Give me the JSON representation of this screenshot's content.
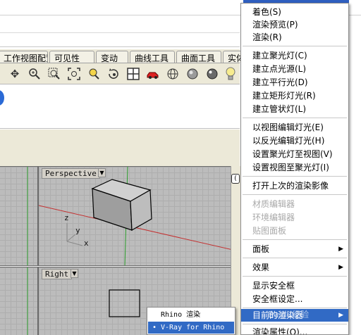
{
  "toolbar_tabs": [
    "工作视图配置",
    "可见性",
    "变动",
    "曲线工具",
    "曲面工具",
    "实体"
  ],
  "toolbar_icons": [
    "move-icon",
    "zoom-in-icon",
    "zoom-window-icon",
    "zoom-extents-icon",
    "zoom-selected-icon",
    "rotate-view-icon",
    "four-viewports-icon",
    "car-render-icon",
    "wireframe-icon",
    "shaded-icon",
    "rendered-icon",
    "light-bulb-icon"
  ],
  "viewports": {
    "perspective": {
      "title": "Perspective",
      "axis_x": "x",
      "axis_y": "y",
      "axis_z": "z"
    },
    "right": {
      "title": "Right"
    }
  },
  "side_tab_label": "(",
  "menu": {
    "items": [
      {
        "label": "着色(S)",
        "disabled": false,
        "submenu": false
      },
      {
        "label": "渲染预览(P)",
        "disabled": false,
        "submenu": false
      },
      {
        "label": "渲染(R)",
        "disabled": false,
        "submenu": false
      },
      {
        "label": "建立聚光灯(C)",
        "disabled": false,
        "submenu": false
      },
      {
        "label": "建立点光源(L)",
        "disabled": false,
        "submenu": false
      },
      {
        "label": "建立平行光(D)",
        "disabled": false,
        "submenu": false
      },
      {
        "label": "建立矩形灯光(R)",
        "disabled": false,
        "submenu": false
      },
      {
        "label": "建立管状灯(L)",
        "disabled": false,
        "submenu": false
      },
      {
        "label": "以视图编辑灯光(E)",
        "disabled": false,
        "submenu": false
      },
      {
        "label": "以反光编辑灯光(H)",
        "disabled": false,
        "submenu": false
      },
      {
        "label": "设置聚光灯至视图(V)",
        "disabled": false,
        "submenu": false
      },
      {
        "label": "设置视图至聚光灯(I)",
        "disabled": false,
        "submenu": false
      },
      {
        "label": "打开上次的渲染影像",
        "disabled": false,
        "submenu": false
      },
      {
        "label": "材质编辑器",
        "disabled": true,
        "submenu": false
      },
      {
        "label": "环境编辑器",
        "disabled": true,
        "submenu": false
      },
      {
        "label": "贴图面板",
        "disabled": true,
        "submenu": false
      },
      {
        "label": "面板",
        "disabled": false,
        "submenu": true
      },
      {
        "label": "效果",
        "disabled": false,
        "submenu": true
      },
      {
        "label": "显示安全框",
        "disabled": false,
        "submenu": false
      },
      {
        "label": "安全框设定...",
        "disabled": false,
        "submenu": false
      },
      {
        "label": "目前的渲染器",
        "disabled": false,
        "submenu": true,
        "selected": true
      },
      {
        "label": "渲染属性(O)...",
        "disabled": false,
        "submenu": false
      }
    ]
  },
  "submenu": {
    "items": [
      {
        "label": "Rhino 渲染",
        "checked": false
      },
      {
        "label": "V-Ray for Rhino",
        "checked": true,
        "selected": true
      }
    ],
    "bullet": "•"
  },
  "watermark": "Baidu经验",
  "colors": {
    "menu_highlight": "#316ac5",
    "window_bg": "#ece9d8",
    "viewport_grid": "#bcbcbc"
  }
}
